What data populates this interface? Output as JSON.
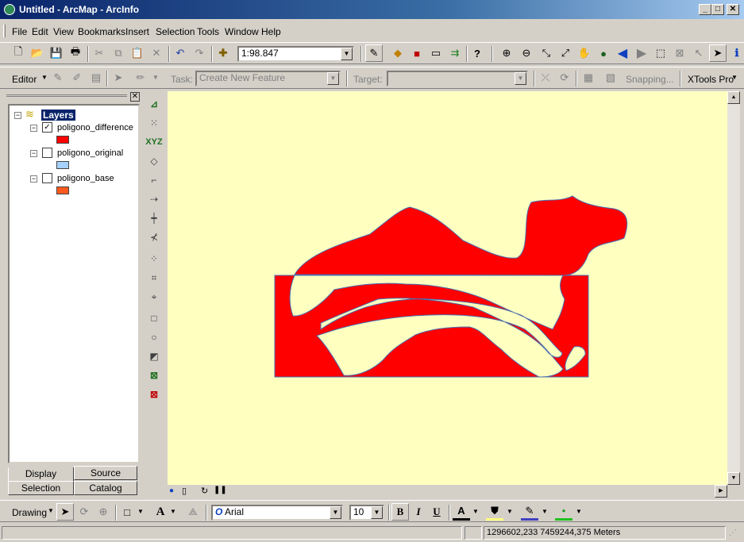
{
  "window": {
    "title": "Untitled - ArcMap - ArcInfo",
    "minimize": "_",
    "maximize": "□",
    "close": "✕"
  },
  "menu": {
    "items": [
      {
        "label": "File"
      },
      {
        "label": "Edit"
      },
      {
        "label": "View"
      },
      {
        "label": "Bookmarks"
      },
      {
        "label": "Insert"
      },
      {
        "label": "Selection"
      },
      {
        "label": "Tools"
      },
      {
        "label": "Window"
      },
      {
        "label": "Help"
      }
    ]
  },
  "standard_toolbar": {
    "scale_value": "1:98.847"
  },
  "editor_toolbar": {
    "editor_label": "Editor",
    "task_label": "Task:",
    "task_value": "Create New Feature",
    "target_label": "Target:",
    "target_value": "",
    "snapping_label": "Snapping...",
    "xtools_label": "XTools Pro"
  },
  "toc": {
    "root_label": "Layers",
    "layers": [
      {
        "name": "poligono_difference",
        "checked": true,
        "color": "#ff0000",
        "check_mark": "✓"
      },
      {
        "name": "poligono_original",
        "checked": false,
        "color": "#a6d2ff",
        "check_mark": ""
      },
      {
        "name": "poligono_base",
        "checked": false,
        "color": "#ff5a1e",
        "check_mark": ""
      }
    ],
    "tabs": {
      "display": "Display",
      "source": "Source",
      "selection": "Selection",
      "catalog": "Catalog"
    }
  },
  "map": {
    "background": "#ffffc0",
    "feature_fill": "#ff0000",
    "feature_outline": "#4a6fb0"
  },
  "drawing_toolbar": {
    "drawing_label": "Drawing",
    "font_name": "Arial",
    "font_size": "10",
    "bold": "B",
    "italic": "I",
    "underline": "U",
    "font_color_glyph": "A"
  },
  "status": {
    "coordinates": "1296602,233  7459244,375 Meters"
  }
}
